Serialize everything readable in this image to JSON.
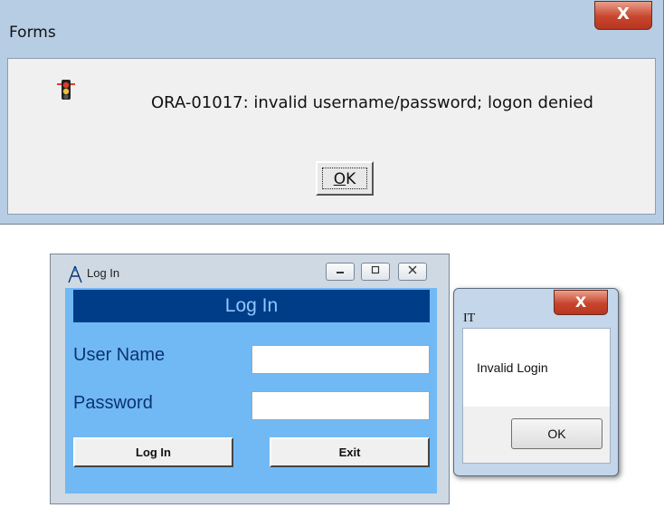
{
  "forms_dialog": {
    "title": "Forms",
    "close_label": "X",
    "message": "ORA-01017: invalid username/password; logon denied",
    "ok_accel": "O",
    "ok_rest": "K",
    "icon": "stop-sign-icon"
  },
  "login_window": {
    "title": "Log In",
    "caption_buttons": [
      "minimize",
      "maximize",
      "close"
    ],
    "banner": "Log In",
    "username_label": "User Name",
    "username_value": "",
    "password_label": "Password",
    "password_value": "",
    "login_button": "Log In",
    "exit_button": "Exit",
    "colors": {
      "client": "#71b9f4",
      "banner": "#003d88"
    }
  },
  "it_dialog": {
    "title": "IT",
    "close_label": "X",
    "message": "Invalid Login",
    "ok_button": "OK"
  }
}
